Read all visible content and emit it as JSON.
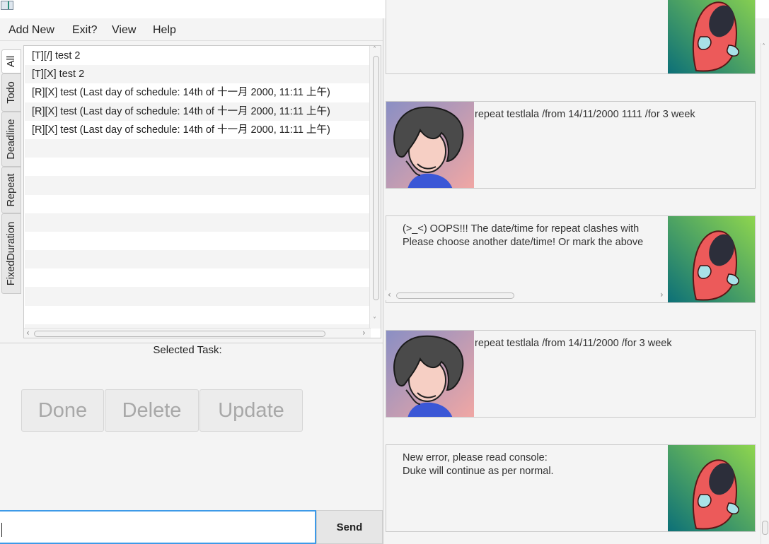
{
  "window": {
    "min_glyph": "—",
    "close_glyph": "✕"
  },
  "menu": [
    "Add New",
    "Exit?",
    "View",
    "Help"
  ],
  "tabs": [
    "All",
    "Todo",
    "Deadline",
    "Repeat",
    "FixedDuration"
  ],
  "active_tab": "All",
  "task_list": [
    "[T][/] test 2",
    "[T][X] test 2",
    "[R][X] test (Last day of schedule: 14th of 十一月 2000, 11:11 上午)",
    "[R][X] test (Last day of schedule: 14th of 十一月 2000, 11:11 上午)",
    "[R][X] test (Last day of schedule: 14th of 十一月 2000, 11:11 上午)"
  ],
  "selected_task_label": "Selected Task:",
  "buttons": {
    "done": "Done",
    "delete": "Delete",
    "update": "Update",
    "send": "Send"
  },
  "input": {
    "value": ""
  },
  "chat": [
    {
      "speaker": "duke",
      "lines": []
    },
    {
      "speaker": "user",
      "lines": [
        "repeat testlala /from 14/11/2000 1111 /for 3 week"
      ]
    },
    {
      "speaker": "duke",
      "lines": [
        "(>_<) OOPS!!! The date/time for repeat clashes with",
        "Please choose another date/time! Or mark the above"
      ]
    },
    {
      "speaker": "user",
      "lines": [
        "repeat testlala /from 14/11/2000 /for 3 week"
      ]
    },
    {
      "speaker": "duke",
      "lines": [
        "New error, please read console:",
        "Duke will continue as per normal."
      ]
    }
  ],
  "icons": {
    "scroll_left": "‹",
    "scroll_right": "›",
    "scroll_up": "˄",
    "scroll_down": "˅"
  },
  "colors": {
    "input_focus": "#3d9ae8",
    "duke_body": "#ec5a5a",
    "duke_bg_light": "#8fd64e",
    "duke_bg_dark": "#0b6f78"
  }
}
